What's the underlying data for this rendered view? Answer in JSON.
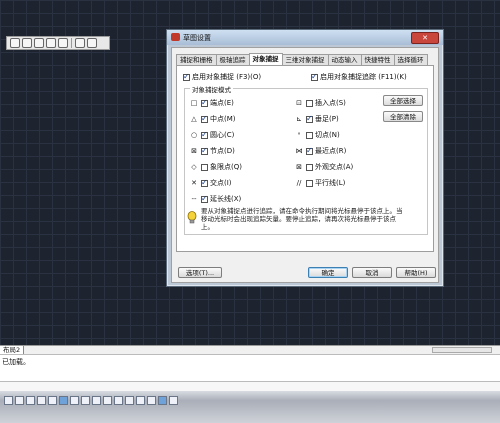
{
  "dialog": {
    "title": "草图设置",
    "close_label": "✕",
    "tabs": [
      {
        "label": "捕捉和栅格",
        "active": false
      },
      {
        "label": "极轴追踪",
        "active": false
      },
      {
        "label": "对象捕捉",
        "active": true
      },
      {
        "label": "三维对象捕捉",
        "active": false
      },
      {
        "label": "动态输入",
        "active": false
      },
      {
        "label": "快捷特性",
        "active": false
      },
      {
        "label": "选择循环",
        "active": false
      }
    ],
    "enable_osnap": {
      "label": "启用对象捕捉 (F3)(O)",
      "checked": true
    },
    "enable_tracking": {
      "label": "启用对象捕捉追踪 (F11)(K)",
      "checked": true
    },
    "group_title": "对象捕捉模式",
    "modes_left": [
      {
        "glyph": "□",
        "label": "端点(E)",
        "checked": true
      },
      {
        "glyph": "△",
        "label": "中点(M)",
        "checked": true
      },
      {
        "glyph": "○",
        "label": "圆心(C)",
        "checked": true
      },
      {
        "glyph": "⊠",
        "label": "节点(D)",
        "checked": true
      },
      {
        "glyph": "◇",
        "label": "象限点(Q)",
        "checked": false
      },
      {
        "glyph": "✕",
        "label": "交点(I)",
        "checked": true
      },
      {
        "glyph": "--",
        "label": "延长线(X)",
        "checked": true
      }
    ],
    "modes_right": [
      {
        "glyph": "⊡",
        "label": "插入点(S)",
        "checked": false
      },
      {
        "glyph": "⊾",
        "label": "垂足(P)",
        "checked": true
      },
      {
        "glyph": "ᐤ",
        "label": "切点(N)",
        "checked": false
      },
      {
        "glyph": "⋈",
        "label": "最近点(R)",
        "checked": true
      },
      {
        "glyph": "⊠",
        "label": "外观交点(A)",
        "checked": false
      },
      {
        "glyph": "//",
        "label": "平行线(L)",
        "checked": false
      }
    ],
    "select_all_label": "全部选择",
    "clear_all_label": "全部清除",
    "info_text": "要从对象捕捉点进行追踪，请在命令执行期间将光标悬停于该点上。当移动光标时会出现追踪矢量。要停止追踪，请再次将光标悬停于该点上。",
    "options_label": "选项(T)...",
    "ok_label": "确定",
    "cancel_label": "取消",
    "help_label": "帮助(H)"
  },
  "layout_tab": "布局2",
  "command_history": "已加载。"
}
